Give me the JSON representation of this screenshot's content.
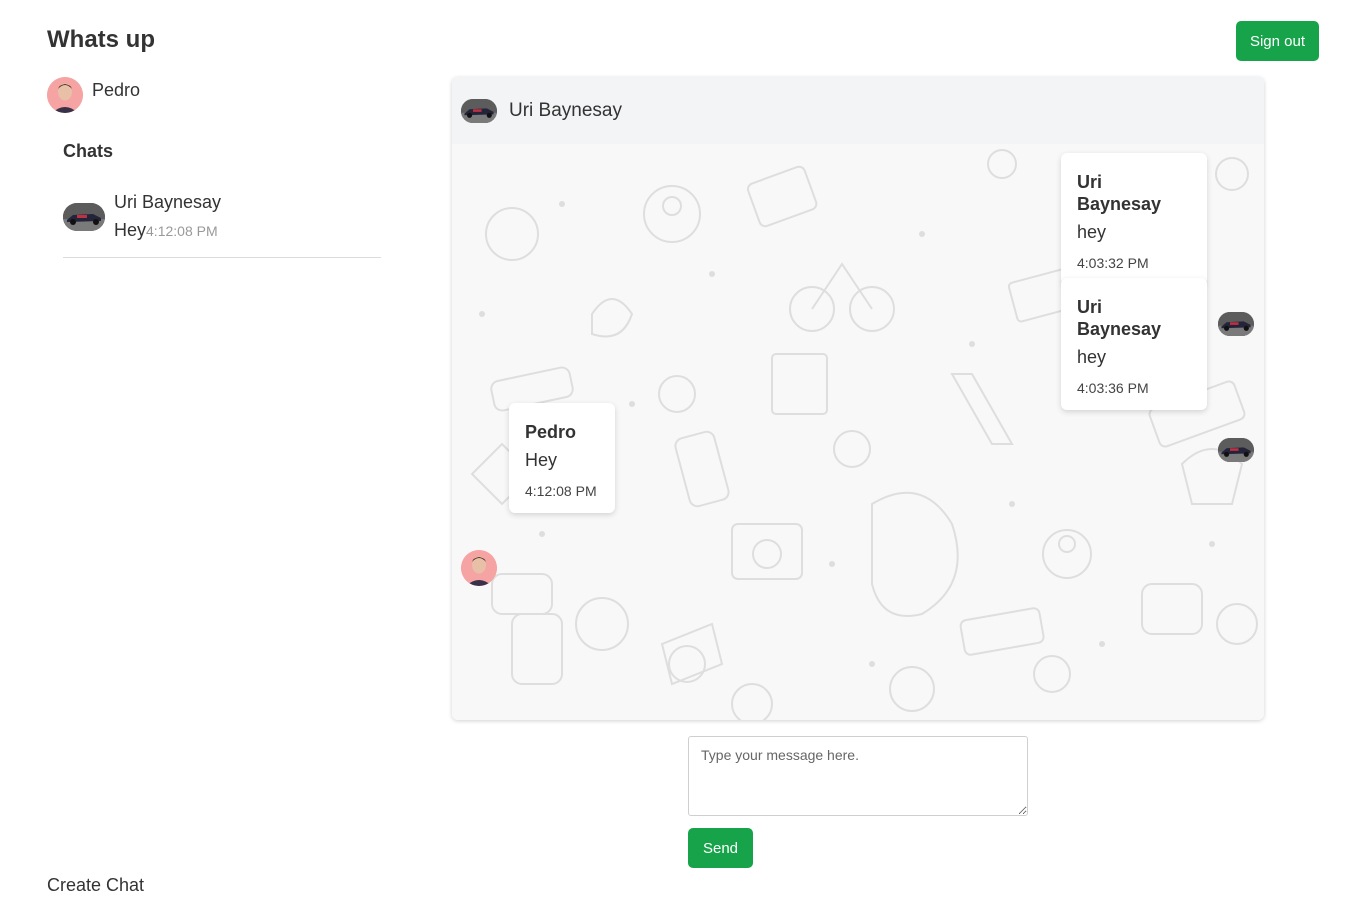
{
  "app": {
    "title": "Whats up",
    "sign_out_label": "Sign out"
  },
  "current_user": {
    "name": "Pedro",
    "avatar_icon": "person-avatar"
  },
  "sidebar": {
    "heading": "Chats",
    "chats": [
      {
        "name": "Uri Baynesay",
        "last_message": "Hey",
        "time": "4:12:08 PM",
        "avatar_icon": "race-car-avatar"
      }
    ],
    "create_chat_label": "Create Chat"
  },
  "conversation": {
    "title": "Uri Baynesay",
    "messages": [
      {
        "sender": "Uri Baynesay",
        "text": "hey",
        "time": "4:03:32 PM",
        "side": "right"
      },
      {
        "sender": "Uri Baynesay",
        "text": "hey",
        "time": "4:03:36 PM",
        "side": "right"
      },
      {
        "sender": "Pedro",
        "text": "Hey",
        "time": "4:12:08 PM",
        "side": "left"
      }
    ]
  },
  "composer": {
    "placeholder": "Type your message here.",
    "value": "",
    "send_label": "Send"
  },
  "colors": {
    "accent": "#16a34a",
    "header_bg": "#f3f4f6",
    "chat_bg": "#f8f8f8"
  }
}
